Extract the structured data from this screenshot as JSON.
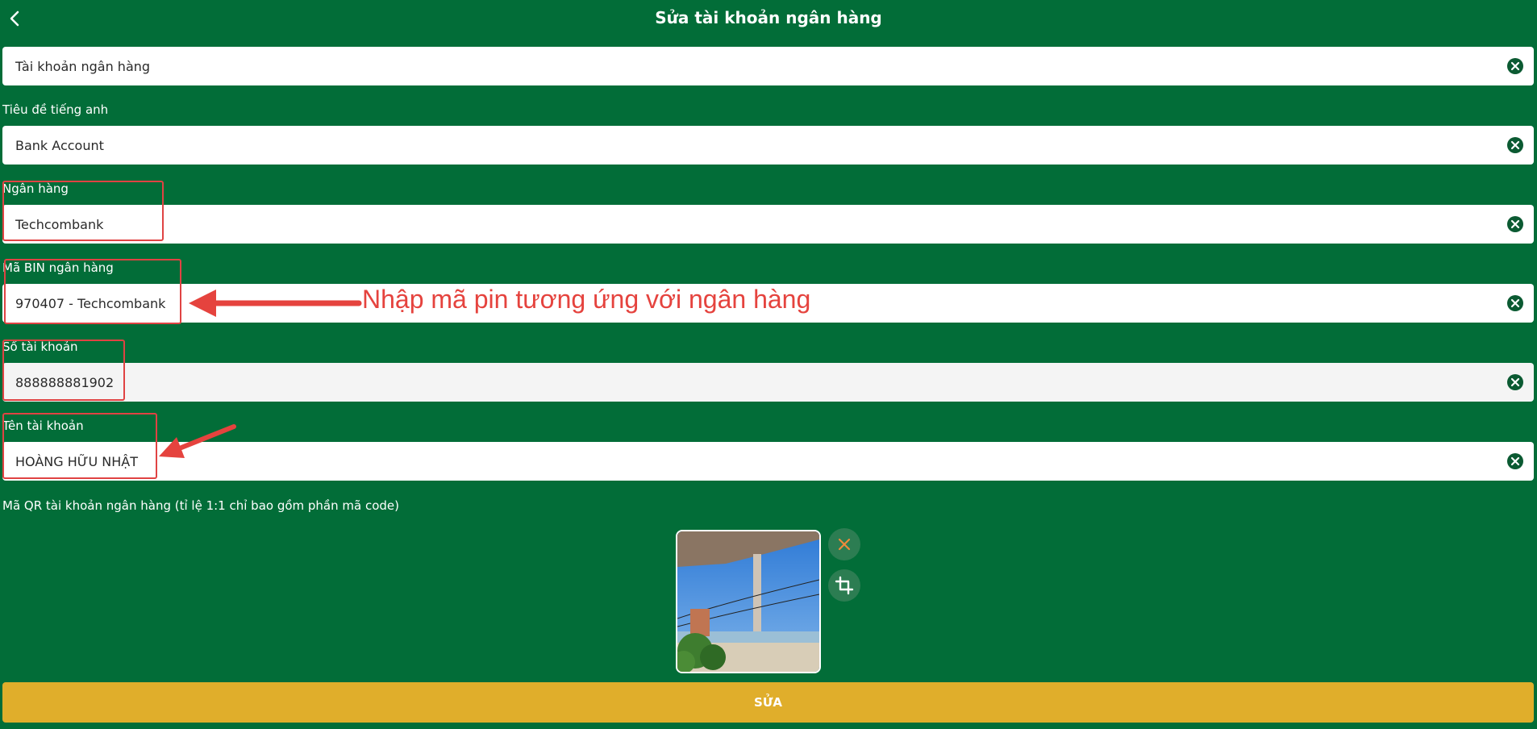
{
  "header": {
    "title": "Sửa tài khoản ngân hàng"
  },
  "form": {
    "account_title": {
      "value": "Tài khoản ngân hàng"
    },
    "english_title": {
      "label": "Tiêu đề tiếng anh",
      "value": "Bank Account"
    },
    "bank": {
      "label": "Ngân hàng",
      "value": "Techcombank"
    },
    "bank_bin": {
      "label": "Mã BIN ngân hàng",
      "value": "970407 - Techcombank"
    },
    "account_number": {
      "label": "Số tài khoản",
      "value": "888888881902"
    },
    "account_name": {
      "label": "Tên tài khoản",
      "value": "HOÀNG HỮU NHẬT"
    },
    "qr": {
      "label": "Mã QR tài khoản ngân hàng (tỉ lệ 1:1 chỉ bao gồm phần mã code)"
    }
  },
  "annotation": {
    "text": "Nhập mã pin tương ứng với ngân hàng"
  },
  "submit_label": "SỬA",
  "colors": {
    "background": "#026d38",
    "highlight": "#e04343",
    "submit": "#e0ae2b",
    "clear_icon": "#0b5a32",
    "remove_x": "#ef8a3b"
  },
  "icons": [
    "back-arrow-icon",
    "clear-icon",
    "close-icon",
    "crop-icon"
  ]
}
